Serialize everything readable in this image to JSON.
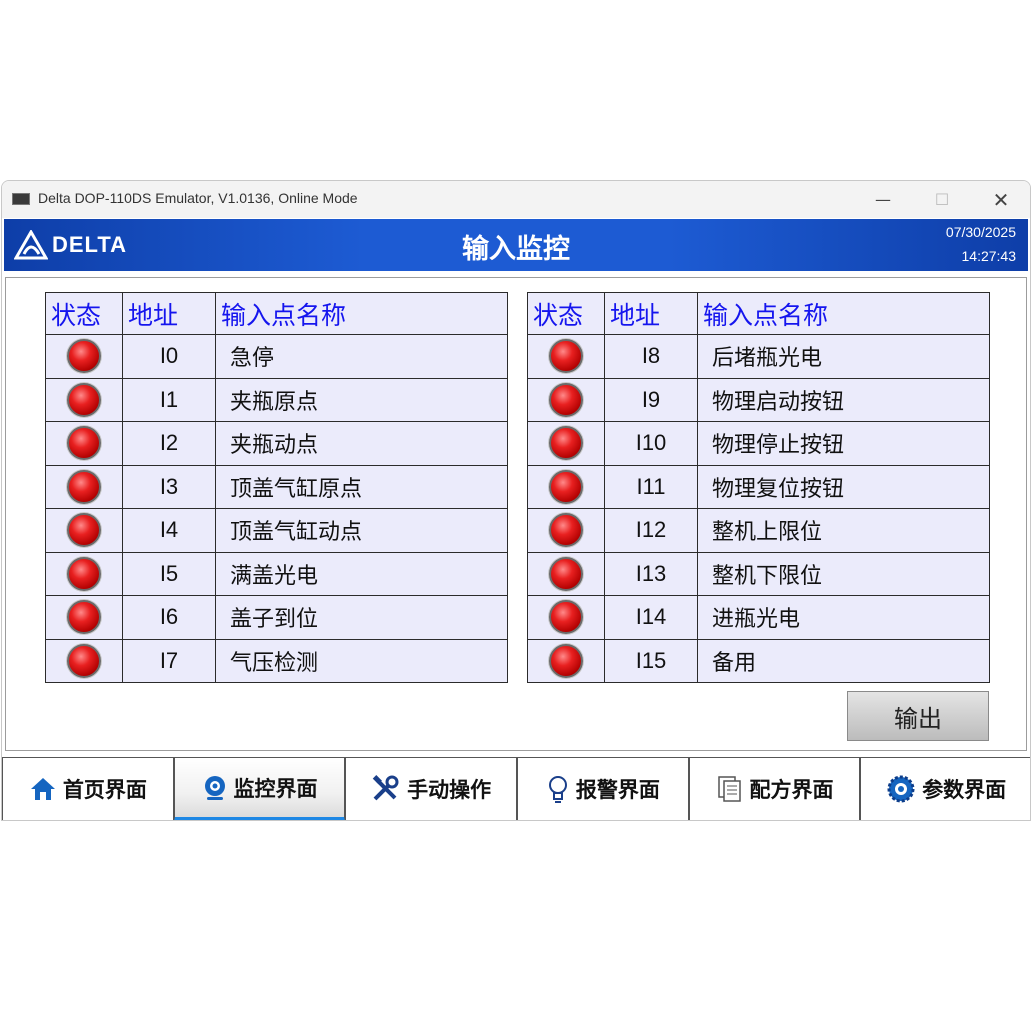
{
  "window": {
    "title": "Delta DOP-110DS Emulator, V1.0136, Online Mode"
  },
  "header": {
    "logo_text": "DELTA",
    "title": "输入监控",
    "date": "07/30/2025",
    "time": "14:27:43"
  },
  "table_headers": {
    "status": "状态",
    "address": "地址",
    "name": "输入点名称"
  },
  "left_rows": [
    {
      "addr": "I0",
      "name": "急停"
    },
    {
      "addr": "I1",
      "name": "夹瓶原点"
    },
    {
      "addr": "I2",
      "name": "夹瓶动点"
    },
    {
      "addr": "I3",
      "name": "顶盖气缸原点"
    },
    {
      "addr": "I4",
      "name": "顶盖气缸动点"
    },
    {
      "addr": "I5",
      "name": "满盖光电"
    },
    {
      "addr": "I6",
      "name": "盖子到位"
    },
    {
      "addr": "I7",
      "name": "气压检测"
    }
  ],
  "right_rows": [
    {
      "addr": "I8",
      "name": "后堵瓶光电"
    },
    {
      "addr": "I9",
      "name": "物理启动按钮"
    },
    {
      "addr": "I10",
      "name": "物理停止按钮"
    },
    {
      "addr": "I11",
      "name": "物理复位按钮"
    },
    {
      "addr": "I12",
      "name": "整机上限位"
    },
    {
      "addr": "I13",
      "name": "整机下限位"
    },
    {
      "addr": "I14",
      "name": "进瓶光电"
    },
    {
      "addr": "I15",
      "name": "备用"
    }
  ],
  "output_button": "输出",
  "nav": [
    {
      "label": "首页界面",
      "icon": "home-icon"
    },
    {
      "label": "监控界面",
      "icon": "webcam-icon",
      "active": true
    },
    {
      "label": "手动操作",
      "icon": "tools-icon"
    },
    {
      "label": "报警界面",
      "icon": "bulb-icon"
    },
    {
      "label": "配方界面",
      "icon": "document-icon"
    },
    {
      "label": "参数界面",
      "icon": "gear-icon"
    }
  ],
  "colors": {
    "header_blue": "#1d5bd3",
    "header_text_blue": "#1515ee",
    "led_red": "#e82020",
    "active_tab": "#1e88e5"
  }
}
